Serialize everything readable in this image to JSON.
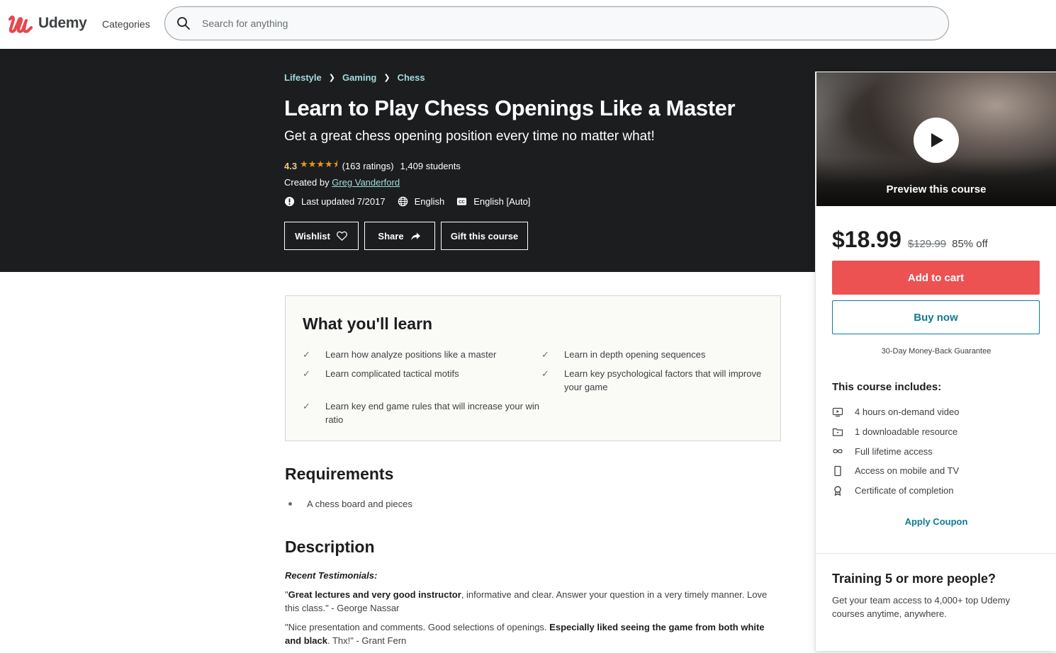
{
  "header": {
    "brand": "Udemy",
    "categories_label": "Categories",
    "search_placeholder": "Search for anything",
    "brand_color": "#ec5252"
  },
  "course": {
    "breadcrumb": [
      "Lifestyle",
      "Gaming",
      "Chess"
    ],
    "title": "Learn to Play Chess Openings Like a Master",
    "subtitle": "Get a great chess opening position every time no matter what!",
    "rating": "4.3",
    "rating_value": 4.3,
    "rating_max": 5,
    "ratings_count": "(163 ratings)",
    "students": "1,409 students",
    "created_by_label": "Created by",
    "instructor": "Greg Vanderford",
    "last_updated": "Last updated 7/2017",
    "language": "English",
    "captions": "English [Auto]",
    "buttons": {
      "wishlist": "Wishlist",
      "share": "Share",
      "gift": "Gift this course"
    }
  },
  "sidebar": {
    "preview_label": "Preview this course",
    "price": "$18.99",
    "original_price": "$129.99",
    "discount": "85% off",
    "add_to_cart": "Add to cart",
    "buy_now": "Buy now",
    "guarantee": "30-Day Money-Back Guarantee",
    "includes_title": "This course includes:",
    "includes": [
      {
        "icon": "video-icon",
        "label": "4 hours on-demand video"
      },
      {
        "icon": "folder-download-icon",
        "label": "1 downloadable resource"
      },
      {
        "icon": "infinity-icon",
        "label": "Full lifetime access"
      },
      {
        "icon": "mobile-icon",
        "label": "Access on mobile and TV"
      },
      {
        "icon": "certificate-icon",
        "label": "Certificate of completion"
      }
    ],
    "apply_coupon": "Apply Coupon",
    "training_title": "Training 5 or more people?",
    "training_text": "Get your team access to 4,000+ top Udemy courses anytime, anywhere.",
    "accent_color": "#0f7c90",
    "cart_color": "#ec5252"
  },
  "learn": {
    "title": "What you'll learn",
    "items": [
      "Learn how analyze positions like a master",
      "Learn in depth opening sequences",
      "Learn complicated tactical motifs",
      "Learn key psychological factors that will improve your game",
      "Learn key end game rules that will increase your win ratio"
    ]
  },
  "requirements": {
    "title": "Requirements",
    "items": [
      "A chess board and pieces"
    ]
  },
  "description": {
    "title": "Description",
    "intro": "Recent Testimonials:",
    "testimonials": [
      {
        "open": "\"",
        "bold": "Great lectures and very good instructor",
        "rest": ", informative and clear. Answer your question in a very timely manner. Love this class.\" - George Nassar"
      },
      {
        "open": "\"Nice presentation and comments. Good selections of openings. ",
        "bold": "Especially liked seeing the game from both white and black",
        "rest": ". Thx!\" - Grant Fern"
      }
    ]
  }
}
